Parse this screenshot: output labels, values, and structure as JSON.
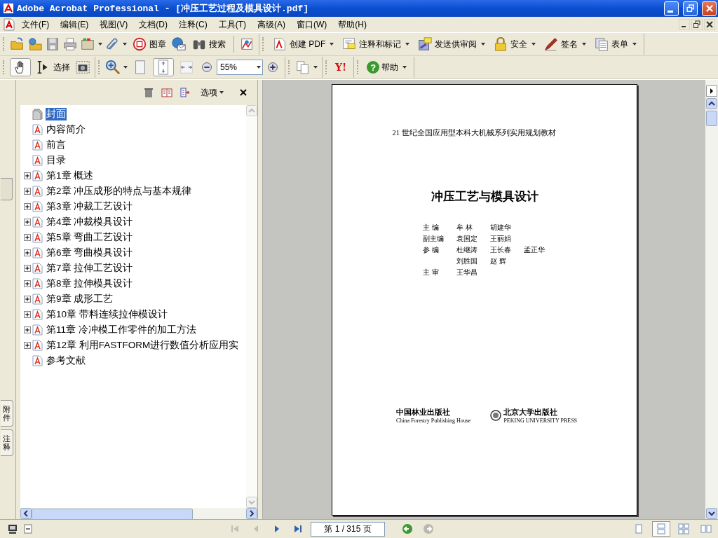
{
  "window": {
    "title": "Adobe Acrobat Professional - [冲压工艺过程及模具设计.pdf]"
  },
  "menu": [
    "文件(F)",
    "编辑(E)",
    "视图(V)",
    "文档(D)",
    "注释(C)",
    "工具(T)",
    "高级(A)",
    "窗口(W)",
    "帮助(H)"
  ],
  "toolbar_1": {
    "stamp": "图章",
    "search": "搜索",
    "create_pdf": "创建 PDF",
    "comment": "注释和标记",
    "review": "发送供审阅",
    "secure": "安全",
    "sign": "签名",
    "forms": "表单"
  },
  "toolbar_2": {
    "hand_tool": {
      "selected": true
    },
    "select_tool": {
      "label": "选择",
      "selected": false
    },
    "actual_size": {
      "selected": false
    },
    "fit_page": {
      "selected": true
    },
    "fit_width": {
      "selected": false
    },
    "zoom": "55%",
    "yahoo": "Y!",
    "help_mark": "?",
    "help": "帮助"
  },
  "side_tabs": [
    "附件",
    "注释"
  ],
  "bookmarks": {
    "options": "选项",
    "items": [
      {
        "label": "封面",
        "kind": "page",
        "selected": true
      },
      {
        "label": "内容简介",
        "kind": "page",
        "selected": false
      },
      {
        "label": "前言",
        "kind": "page",
        "selected": false
      },
      {
        "label": "目录",
        "kind": "page",
        "selected": false
      },
      {
        "label": "第1章 概述",
        "kind": "chapter",
        "expanded": false,
        "selected": false
      },
      {
        "label": "第2章 冲压成形的特点与基本规律",
        "kind": "chapter",
        "expanded": false,
        "selected": false
      },
      {
        "label": "第3章 冲裁工艺设计",
        "kind": "chapter",
        "expanded": false,
        "selected": false
      },
      {
        "label": "第4章 冲裁模具设计",
        "kind": "chapter",
        "expanded": false,
        "selected": false
      },
      {
        "label": "第5章 弯曲工艺设计",
        "kind": "chapter",
        "expanded": false,
        "selected": false
      },
      {
        "label": "第6章 弯曲模具设计",
        "kind": "chapter",
        "expanded": false,
        "selected": false
      },
      {
        "label": "第7章 拉伸工艺设计",
        "kind": "chapter",
        "expanded": false,
        "selected": false
      },
      {
        "label": "第8章 拉伸模具设计",
        "kind": "chapter",
        "expanded": false,
        "selected": false
      },
      {
        "label": "第9章 成形工艺",
        "kind": "chapter",
        "expanded": false,
        "selected": false
      },
      {
        "label": "第10章 带料连续拉伸模设计",
        "kind": "chapter",
        "expanded": false,
        "selected": false
      },
      {
        "label": "第11章 冷冲模工作零件的加工方法",
        "kind": "chapter",
        "expanded": false,
        "selected": false
      },
      {
        "label": "第12章 利用FASTFORM进行数值分析应用实",
        "kind": "chapter",
        "expanded": false,
        "selected": false
      },
      {
        "label": "参考文献",
        "kind": "page",
        "selected": false
      }
    ]
  },
  "page": {
    "series": "21 世纪全国应用型本科大机械系列实用规划教材",
    "title": "冲压工艺与模具设计",
    "credits": [
      {
        "role": "主 编",
        "names": [
          "牟 林",
          "胡建华"
        ]
      },
      {
        "role": "副主编",
        "names": [
          "袁国定",
          "王丽娟"
        ]
      },
      {
        "role": "参 编",
        "names": [
          "杜继涛",
          "王长春",
          "孟正华"
        ]
      },
      {
        "names": [
          "刘胜国",
          "赵 辉"
        ]
      },
      {
        "role": "主 审",
        "names": [
          "王华昌"
        ]
      }
    ],
    "publishers": [
      {
        "name": "中国林业出版社",
        "english": "China Forestry Publishing House",
        "kind": "plain"
      },
      {
        "name": "北京大学出版社",
        "english": "PEKING UNIVERSITY PRESS",
        "kind": "emblem"
      }
    ]
  },
  "status_bar": {
    "page": "第 1 / 315 页",
    "nav_buttons": [
      {
        "kind": "first",
        "disabled": true
      },
      {
        "kind": "prev",
        "disabled": true
      },
      {
        "kind": "next",
        "disabled": false
      },
      {
        "kind": "last",
        "disabled": false
      }
    ],
    "history_buttons": [
      {
        "kind": "back",
        "disabled": false
      },
      {
        "kind": "forward",
        "disabled": true
      }
    ],
    "page_layouts": [
      {
        "selected": false
      },
      {
        "selected": true
      },
      {
        "selected": false
      },
      {
        "selected": false
      }
    ]
  }
}
